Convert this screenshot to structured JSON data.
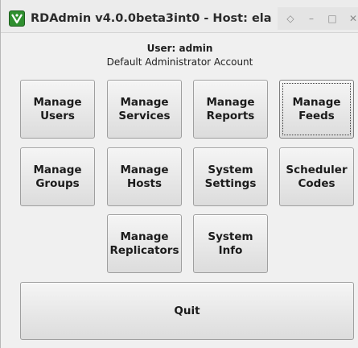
{
  "window": {
    "title": "RDAdmin v4.0.0beta3int0 - Host: ela",
    "controls": {
      "up": "◇",
      "minimize": "–",
      "maximize": "□",
      "close": "✕"
    }
  },
  "header": {
    "user": "User: admin",
    "description": "Default Administrator Account"
  },
  "buttons": {
    "manage_users": "Manage\nUsers",
    "manage_services": "Manage\nServices",
    "manage_reports": "Manage\nReports",
    "manage_feeds": "Manage\nFeeds",
    "manage_groups": "Manage\nGroups",
    "manage_hosts": "Manage\nHosts",
    "system_settings": "System\nSettings",
    "scheduler_codes": "Scheduler\nCodes",
    "manage_replicators": "Manage\nReplicators",
    "system_info": "System\nInfo",
    "quit": "Quit"
  },
  "colors": {
    "app_icon": "#2f8f2f",
    "window_bg": "#f0f0f0",
    "button_border": "#9f9f9f"
  }
}
